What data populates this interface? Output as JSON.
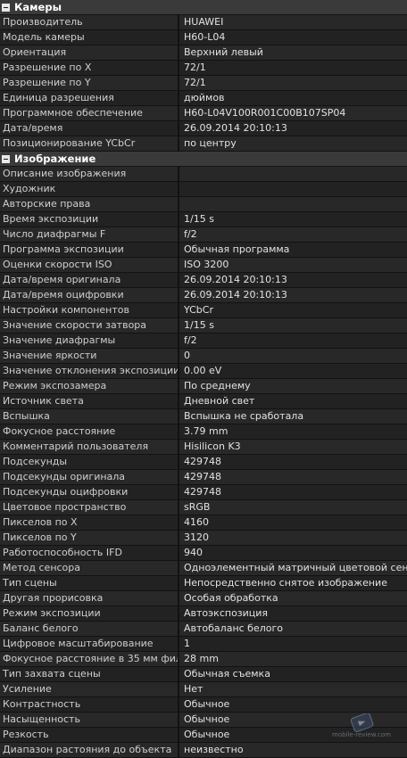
{
  "sections": [
    {
      "title": "Камеры",
      "rows": [
        {
          "key": "Производитель",
          "value": "HUAWEI"
        },
        {
          "key": "Модель камеры",
          "value": "H60-L04"
        },
        {
          "key": "Ориентация",
          "value": "Верхний левый"
        },
        {
          "key": "Разрешение по X",
          "value": "72/1"
        },
        {
          "key": "Разрешение по Y",
          "value": "72/1"
        },
        {
          "key": "Единица разрешения",
          "value": "дюймов"
        },
        {
          "key": "Программное обеспечение",
          "value": "H60-L04V100R001C00B107SP04"
        },
        {
          "key": "Дата/время",
          "value": "26.09.2014 20:10:13"
        },
        {
          "key": "Позиционирование YCbCr",
          "value": "по центру"
        }
      ]
    },
    {
      "title": "Изображение",
      "rows": [
        {
          "key": "Описание изображения",
          "value": ""
        },
        {
          "key": "Художник",
          "value": ""
        },
        {
          "key": "Авторские права",
          "value": ""
        },
        {
          "key": "Время экспозиции",
          "value": "1/15 s"
        },
        {
          "key": "Число диафрагмы F",
          "value": "f/2"
        },
        {
          "key": "Программа экспозиции",
          "value": "Обычная программа"
        },
        {
          "key": "Оценки скорости ISO",
          "value": "ISO 3200"
        },
        {
          "key": "Дата/время оригинала",
          "value": "26.09.2014 20:10:13"
        },
        {
          "key": "Дата/время оцифровки",
          "value": "26.09.2014 20:10:13"
        },
        {
          "key": "Настройки компонентов",
          "value": "YCbCr"
        },
        {
          "key": "Значение скорости затвора",
          "value": "1/15 s"
        },
        {
          "key": "Значение диафрагмы",
          "value": "f/2"
        },
        {
          "key": "Значение яркости",
          "value": "0"
        },
        {
          "key": "Значение отклонения экспозиции",
          "value": "0.00 eV"
        },
        {
          "key": "Режим экспозамера",
          "value": "По среднему"
        },
        {
          "key": "Источник света",
          "value": "Дневной свет"
        },
        {
          "key": "Вспышка",
          "value": "Вспышка не сработала"
        },
        {
          "key": "Фокусное расстояние",
          "value": "3.79 mm"
        },
        {
          "key": "Комментарий пользователя",
          "value": "Hisilicon K3"
        },
        {
          "key": "Подсекунды",
          "value": "429748"
        },
        {
          "key": "Подсекунды оригинала",
          "value": "429748"
        },
        {
          "key": "Подсекунды оцифровки",
          "value": "429748"
        },
        {
          "key": "Цветовое пространство",
          "value": "sRGB"
        },
        {
          "key": "Пикселов по X",
          "value": "4160"
        },
        {
          "key": "Пикселов по Y",
          "value": "3120"
        },
        {
          "key": "Работоспособность IFD",
          "value": "940"
        },
        {
          "key": "Метод сенсора",
          "value": "Одноэлементный матричный цветовой сенсор"
        },
        {
          "key": "Тип сцены",
          "value": "Непосредственно снятое изображение"
        },
        {
          "key": "Другая прорисовка",
          "value": "Особая обработка"
        },
        {
          "key": "Режим экспозиции",
          "value": "Автоэкспозиция"
        },
        {
          "key": "Баланс белого",
          "value": "Автобаланс белого"
        },
        {
          "key": "Цифровое масштабирование",
          "value": "1"
        },
        {
          "key": "Фокусное расстояние в 35 мм филь...",
          "value": "28 mm"
        },
        {
          "key": "Тип захвата сцены",
          "value": "Обычная съемка"
        },
        {
          "key": "Усиление",
          "value": "Нет"
        },
        {
          "key": "Контрастность",
          "value": "Обычное"
        },
        {
          "key": "Насыщенность",
          "value": "Обычное"
        },
        {
          "key": "Резкость",
          "value": "Обычное"
        },
        {
          "key": "Диапазон растояния до объекта",
          "value": "неизвестно"
        }
      ]
    }
  ],
  "watermark": {
    "text": "mobile-review.com",
    "icon": "phone-logo-icon"
  },
  "colors": {
    "background": "#1b1b1b",
    "header": "#3a3a3a",
    "row_odd": "#282828",
    "row_even": "#222222"
  }
}
